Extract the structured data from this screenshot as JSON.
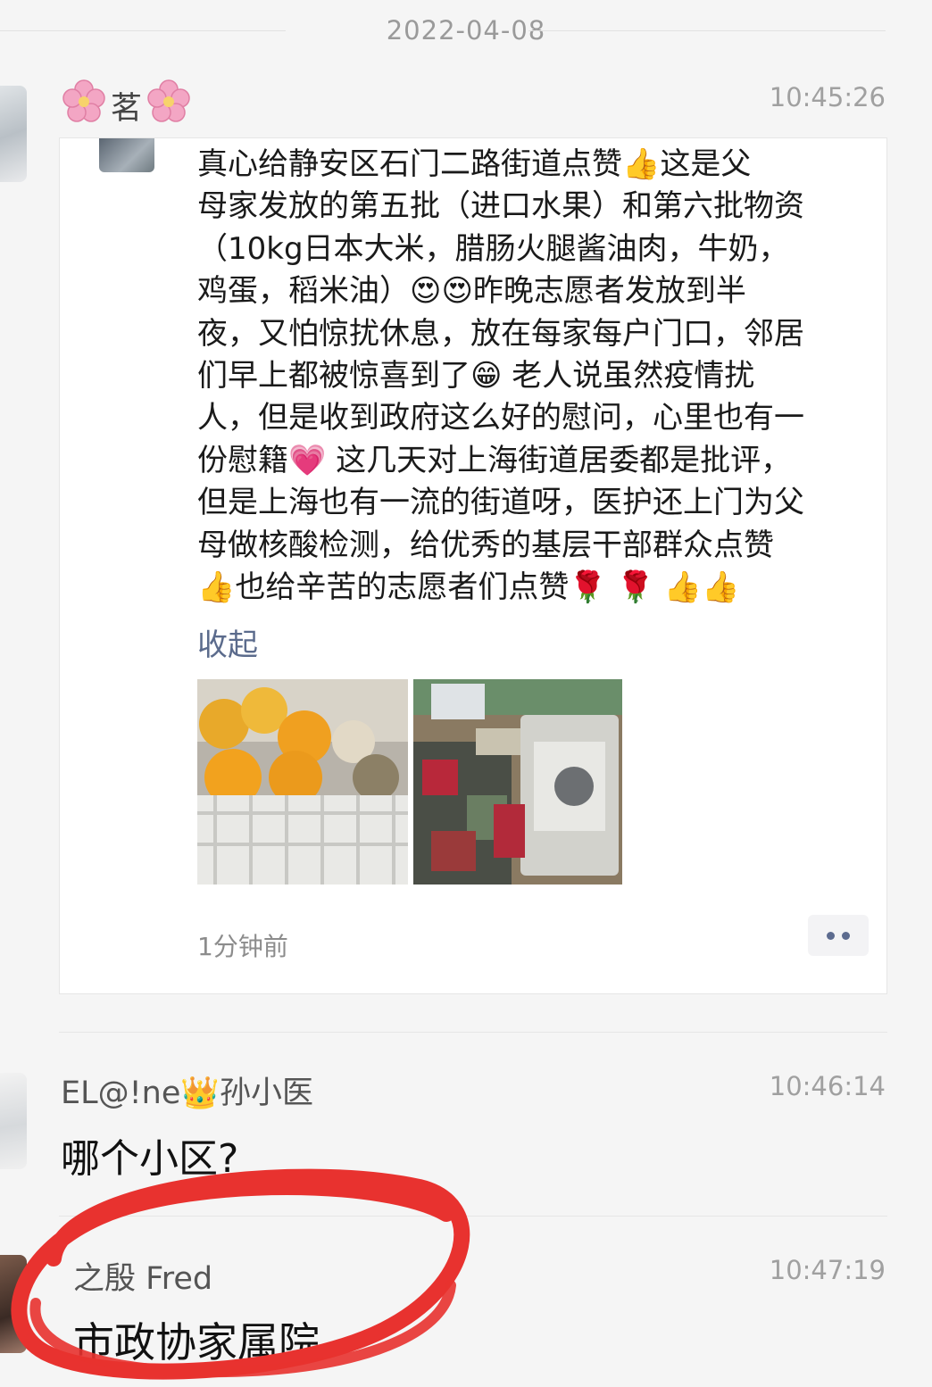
{
  "date_divider": "2022-04-08",
  "messages": [
    {
      "sender": "茗",
      "time": "10:45:26",
      "shared_post": {
        "lines": [
          "真心给静安区石门二路街道点赞👍这是父",
          "母家发放的第五批（进口水果）和第六批物资",
          "（10kg日本大米，腊肠火腿酱油肉，牛奶，",
          "鸡蛋，稻米油）😍😍昨晚志愿者发放到半",
          "夜，又怕惊扰休息，放在每家每户门口，邻居",
          "们早上都被惊喜到了😁 老人说虽然疫情扰",
          "人，但是收到政府这么好的慰问，心里也有一",
          "份慰籍💗 这几天对上海街道居委都是批评，",
          "但是上海也有一流的街道呀，医护还上门为父",
          "母做核酸检测，给优秀的基层干部群众点赞",
          "👍也给辛苦的志愿者们点赞🌹 🌹 👍👍"
        ],
        "collapse_label": "收起",
        "posted_ago": "1分钟前"
      }
    },
    {
      "sender": "EL@!ne👑孙小医",
      "time": "10:46:14",
      "text": "哪个小区?"
    },
    {
      "sender": "之殷 Fred",
      "time": "10:47:19",
      "text": "市政协家属院"
    }
  ],
  "colors": {
    "background": "#f5f5f5",
    "card": "#ffffff",
    "link_blue": "#5b6b8c",
    "annotation_red": "#e8322f"
  }
}
